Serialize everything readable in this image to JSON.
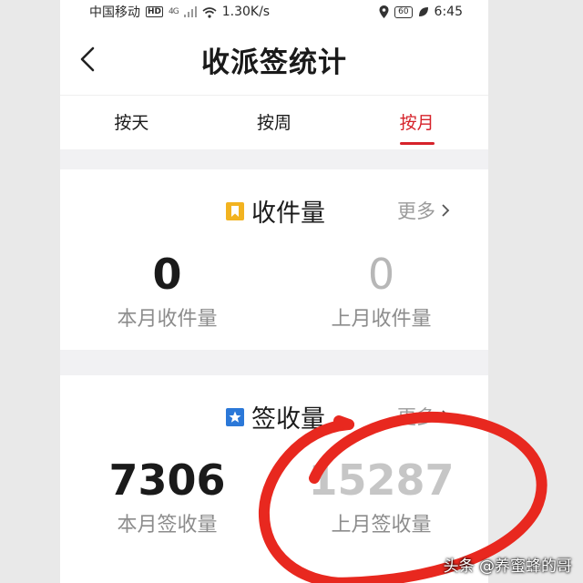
{
  "status_bar": {
    "carrier": "中国移动",
    "hd": "HD",
    "net": "4G",
    "speed": "1.30K/s",
    "battery": "60",
    "time": "6:45"
  },
  "header": {
    "title": "收派签统计"
  },
  "tabs": [
    {
      "label": "按天"
    },
    {
      "label": "按周"
    },
    {
      "label": "按月"
    }
  ],
  "sections": [
    {
      "title": "收件量",
      "more": "更多",
      "icon_color": "#f2b320",
      "stats": [
        {
          "value": "0",
          "label": "本月收件量"
        },
        {
          "value": "0",
          "label": "上月收件量"
        }
      ]
    },
    {
      "title": "签收量",
      "more": "更多",
      "icon_color": "#2b78d8",
      "stats": [
        {
          "value": "7306",
          "label": "本月签收量"
        },
        {
          "value": "15287",
          "label": "上月签收量"
        }
      ]
    }
  ],
  "watermark": "头条 @养蜜蜂的哥",
  "colors": {
    "accent": "#d6222a",
    "annotation": "#e8281f"
  }
}
